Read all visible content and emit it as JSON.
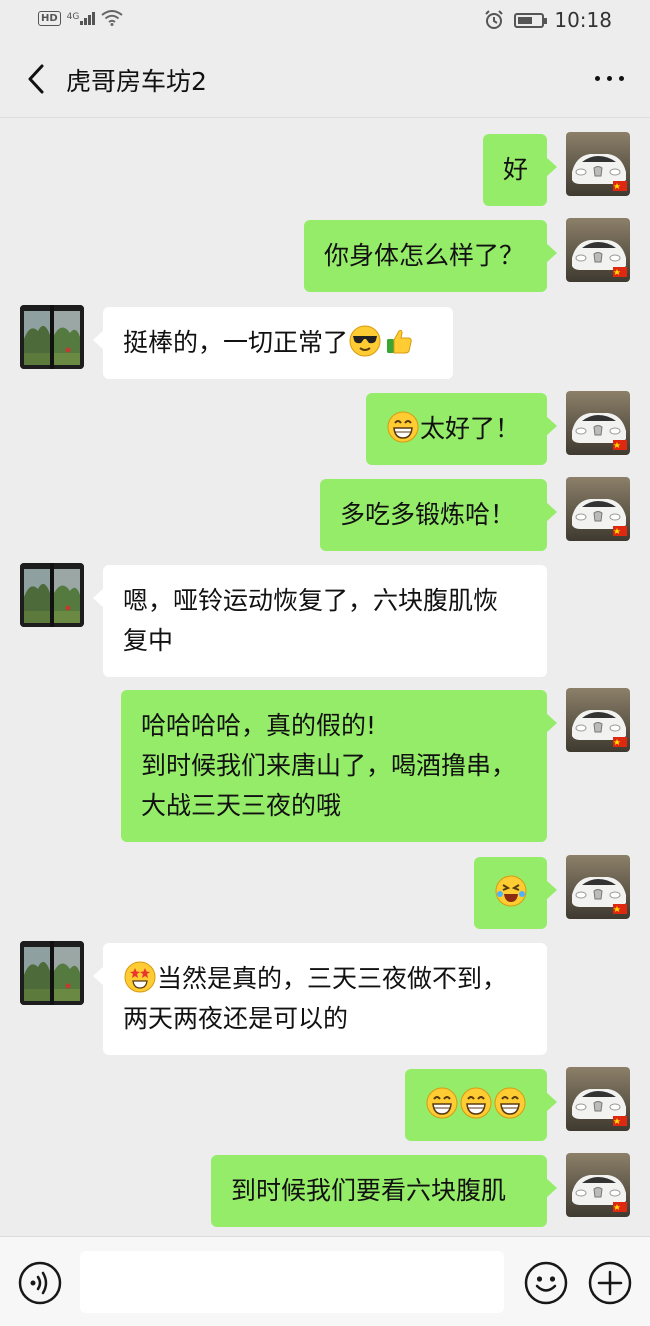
{
  "status": {
    "time": "10:18",
    "network": "4G",
    "hd": "HD"
  },
  "header": {
    "title": "虎哥房车坊2"
  },
  "colors": {
    "outgoing_bubble": "#95ec69",
    "incoming_bubble": "#ffffff",
    "background": "#ededed"
  },
  "messages": [
    {
      "side": "out",
      "lines": [
        [
          "好"
        ]
      ]
    },
    {
      "side": "out",
      "lines": [
        [
          "你身体怎么样了？"
        ]
      ]
    },
    {
      "side": "in",
      "lines": [
        [
          "挺棒的，一切正常了",
          {
            "emoji": "cool-sunglasses"
          },
          {
            "emoji": "thumbs-up"
          }
        ]
      ]
    },
    {
      "side": "out",
      "lines": [
        [
          {
            "emoji": "grin"
          },
          "太好了！"
        ]
      ]
    },
    {
      "side": "out",
      "lines": [
        [
          "多吃多锻炼哈！"
        ]
      ]
    },
    {
      "side": "in",
      "lines": [
        [
          "嗯，哑铃运动恢复了，六块腹肌恢"
        ],
        [
          "复中"
        ]
      ]
    },
    {
      "side": "out",
      "lines": [
        [
          "哈哈哈哈，真的假的!"
        ],
        [
          "到时候我们来唐山了，喝酒撸串，"
        ],
        [
          "大战三天三夜的哦"
        ]
      ]
    },
    {
      "side": "out",
      "lines": [
        [
          {
            "emoji": "rofl"
          }
        ]
      ]
    },
    {
      "side": "in",
      "lines": [
        [
          {
            "emoji": "star-struck"
          },
          "当然是真的，三天三夜做不到，"
        ],
        [
          "两天两夜还是可以的"
        ]
      ]
    },
    {
      "side": "out",
      "lines": [
        [
          {
            "emoji": "grin"
          },
          {
            "emoji": "grin"
          },
          {
            "emoji": "grin"
          }
        ]
      ]
    },
    {
      "side": "out",
      "lines": [
        [
          "到时候我们要看六块腹肌"
        ]
      ]
    }
  ],
  "input": {
    "placeholder": ""
  }
}
